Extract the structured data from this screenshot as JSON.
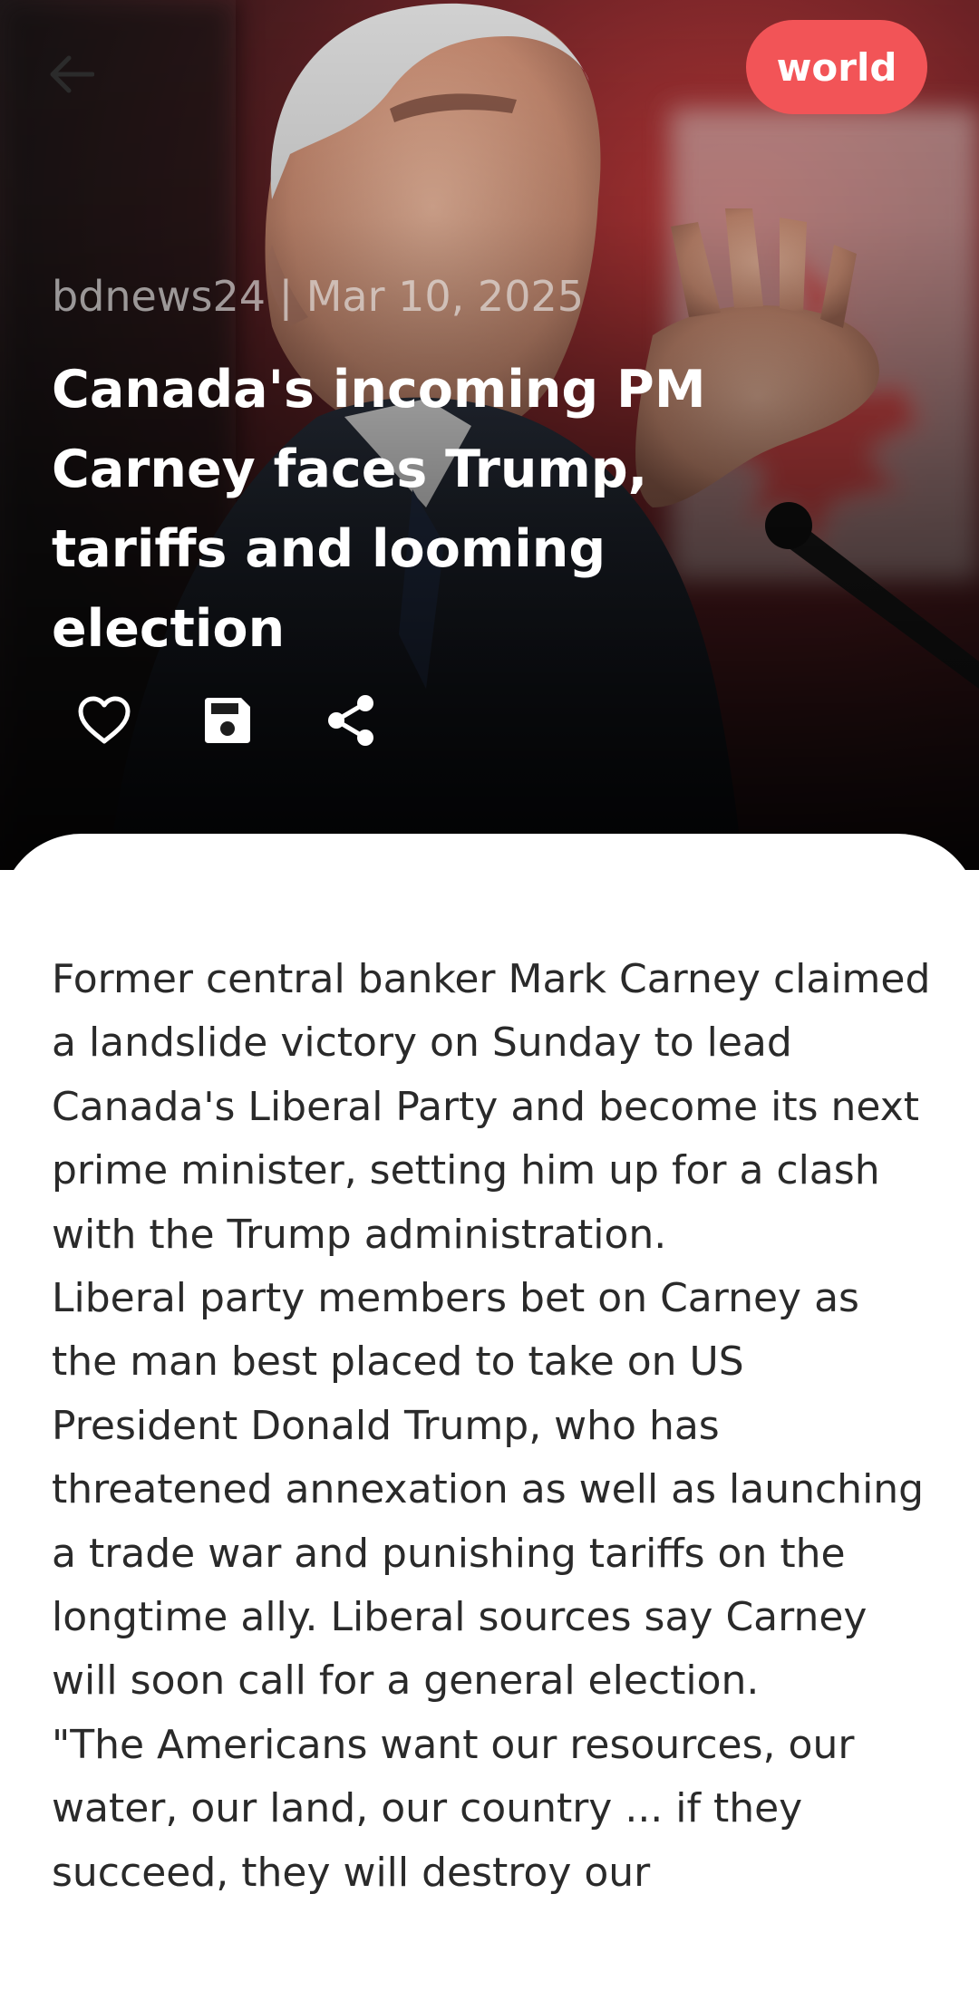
{
  "header": {
    "back_icon": "arrow-left-icon",
    "category": "world"
  },
  "article": {
    "source": "bdnews24",
    "separator": "|",
    "date": "Mar 10, 2025",
    "title": "Canada's incoming PM Carney faces Trump, tariffs and looming election",
    "paragraphs": [
      "Former central banker Mark Carney claimed a landslide victory on Sunday to lead Canada's Liberal Party and become its next prime minister, setting him up for a clash with the Trump administration.",
      "Liberal party members bet on Carney as the man best placed to take on US President Donald Trump, who has threatened annexation as well as launching a trade war and punishing tariffs on the longtime ally. Liberal sources say Carney will soon call for a general election.",
      "\"The Americans want our resources, our water, our land, our country ... if they succeed, they will destroy our"
    ]
  },
  "actions": {
    "like_icon": "heart-outline-icon",
    "save_icon": "floppy-disk-icon",
    "share_icon": "share-icon"
  },
  "colors": {
    "badge": "#f25457",
    "title": "#ffffff",
    "meta": "#ebebeb",
    "body_text": "#2a2a2a",
    "card": "#ffffff"
  }
}
